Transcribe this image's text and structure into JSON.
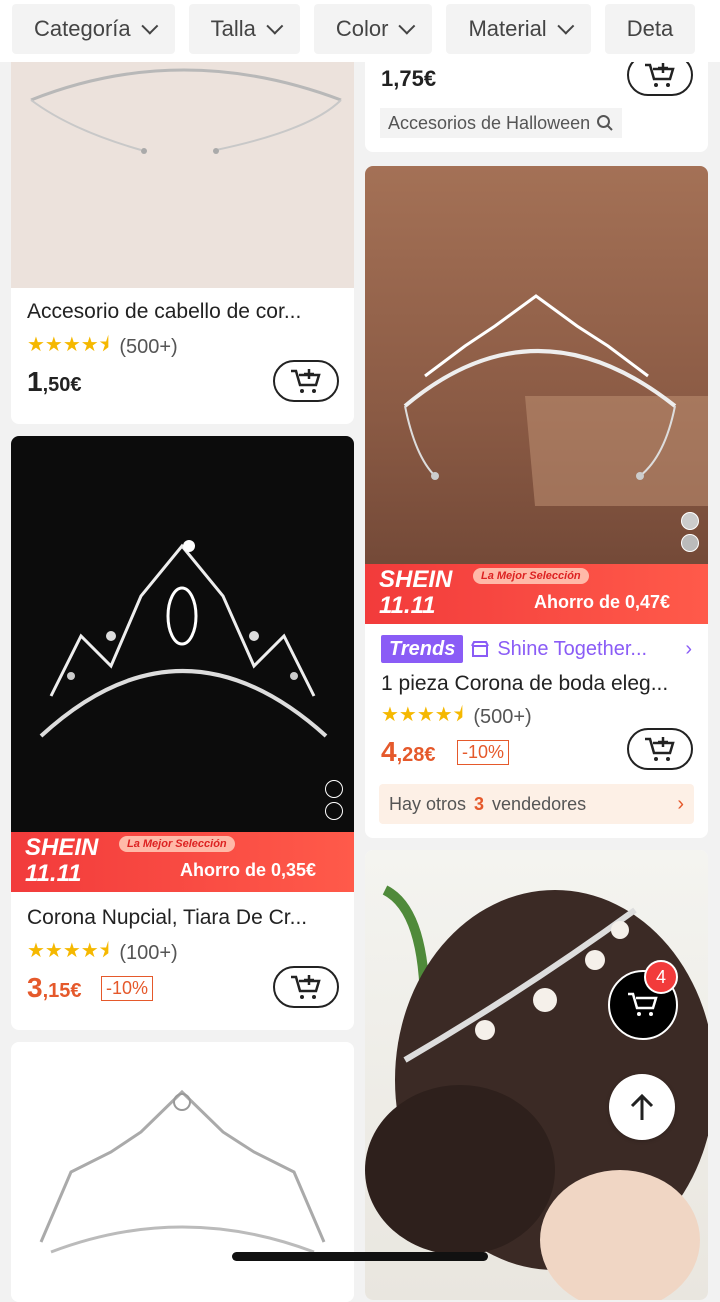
{
  "filters": [
    "Categoría",
    "Talla",
    "Color",
    "Material",
    "Deta"
  ],
  "left_col": {
    "card1": {
      "title": "Accesorio de cabello de cor...",
      "stars": "★★★★⯨",
      "rating_count": "(500+)",
      "price_int": "1",
      "price_dec": ",50€"
    },
    "card2": {
      "banner_brand": "SHEIN",
      "banner_event": "11.11",
      "banner_pill": "La Mejor Selección",
      "banner_save": "Ahorro de 0,35€",
      "title": "Corona Nupcial, Tiara De Cr...",
      "stars": "★★★★⯨",
      "rating_count": "(100+)",
      "price_int": "3",
      "price_dec": ",15€",
      "discount": "-10%",
      "swatch_colors": [
        "#d8d8d8",
        "#c9722e"
      ]
    }
  },
  "right_col": {
    "card0": {
      "price_partial": "1,75€",
      "search_tag": "Accesorios de Halloween"
    },
    "card1": {
      "banner_brand": "SHEIN",
      "banner_event": "11.11",
      "banner_pill": "La Mejor Selección",
      "banner_save": "Ahorro de 0,47€",
      "trends_label": "Trends",
      "shine_label": "Shine Together...",
      "title": "1 pieza Corona de boda eleg...",
      "stars": "★★★★⯨",
      "rating_count": "(500+)",
      "price_int": "4",
      "price_dec": ",28€",
      "discount": "-10%",
      "sellers_prefix": "Hay otros",
      "sellers_count": "3",
      "sellers_suffix": "vendedores"
    }
  },
  "cart_badge": "4",
  "colors": {
    "accent": "#e5592b",
    "banner_red": "#f23b3b",
    "trends_purple": "#8a5cf6"
  }
}
